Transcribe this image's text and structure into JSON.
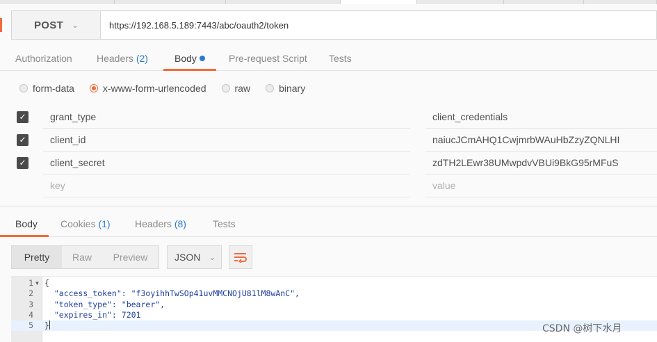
{
  "request": {
    "method": "POST",
    "url": "https://192.168.5.189:7443/abc/oauth2/token"
  },
  "request_tabs": [
    {
      "label": "Authorization",
      "count": ""
    },
    {
      "label": "Headers",
      "count": "(2)"
    },
    {
      "label": "Body",
      "count": ""
    },
    {
      "label": "Pre-request Script",
      "count": ""
    },
    {
      "label": "Tests",
      "count": ""
    }
  ],
  "body_types": [
    {
      "label": "form-data",
      "selected": false
    },
    {
      "label": "x-www-form-urlencoded",
      "selected": true
    },
    {
      "label": "raw",
      "selected": false
    },
    {
      "label": "binary",
      "selected": false
    }
  ],
  "params": [
    {
      "key": "grant_type",
      "value": "client_credentials",
      "checked": true
    },
    {
      "key": "client_id",
      "value": "naiucJCmAHQ1CwjmrbWAuHbZzyZQNLHI",
      "checked": true
    },
    {
      "key": "client_secret",
      "value": "zdTH2LEwr38UMwpdvVBUi9BkG95rMFuS",
      "checked": true
    }
  ],
  "new_param": {
    "key_placeholder": "key",
    "value_placeholder": "value"
  },
  "response_tabs": [
    {
      "label": "Body",
      "count": ""
    },
    {
      "label": "Cookies",
      "count": "(1)"
    },
    {
      "label": "Headers",
      "count": "(8)"
    },
    {
      "label": "Tests",
      "count": ""
    }
  ],
  "view_modes": [
    "Pretty",
    "Raw",
    "Preview"
  ],
  "format": "JSON",
  "response_lines": [
    {
      "num": "1",
      "text": "{"
    },
    {
      "num": "2",
      "text": "  \"access_token\": \"f3oyihhTwSOp41uvMMCNOjU81lM8wAnC\","
    },
    {
      "num": "3",
      "text": "  \"token_type\": \"bearer\","
    },
    {
      "num": "4",
      "text": "  \"expires_in\": 7201"
    },
    {
      "num": "5",
      "text": "}"
    }
  ],
  "watermark": "CSDN @树下水月",
  "colors": {
    "accent": "#f26b3a",
    "link": "#2a7ad1"
  }
}
